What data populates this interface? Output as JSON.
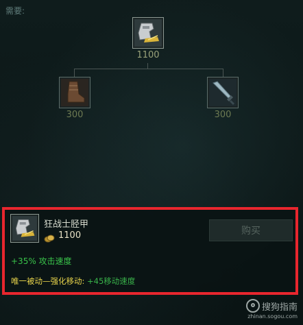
{
  "header": {
    "label": "需要:"
  },
  "recipe": {
    "top": {
      "icon": "berserker-greaves-icon",
      "price": "1100"
    },
    "left": {
      "icon": "boots-icon",
      "price": "300"
    },
    "right": {
      "icon": "dagger-icon",
      "price": "300"
    }
  },
  "info": {
    "icon": "berserker-greaves-icon",
    "name": "狂战士胫甲",
    "cost": "1100",
    "buy_label": "购买",
    "stat": "+35% 攻击速度",
    "passive_name": "唯一被动—强化移动:",
    "passive_value": " +45移动速度"
  },
  "watermark": {
    "title": "搜狗指南",
    "url": "zhinan.sogou.com"
  },
  "colors": {
    "panel_border": "#e8262e",
    "stat_green": "#39c34a",
    "passive_yellow": "#e7d34b"
  }
}
